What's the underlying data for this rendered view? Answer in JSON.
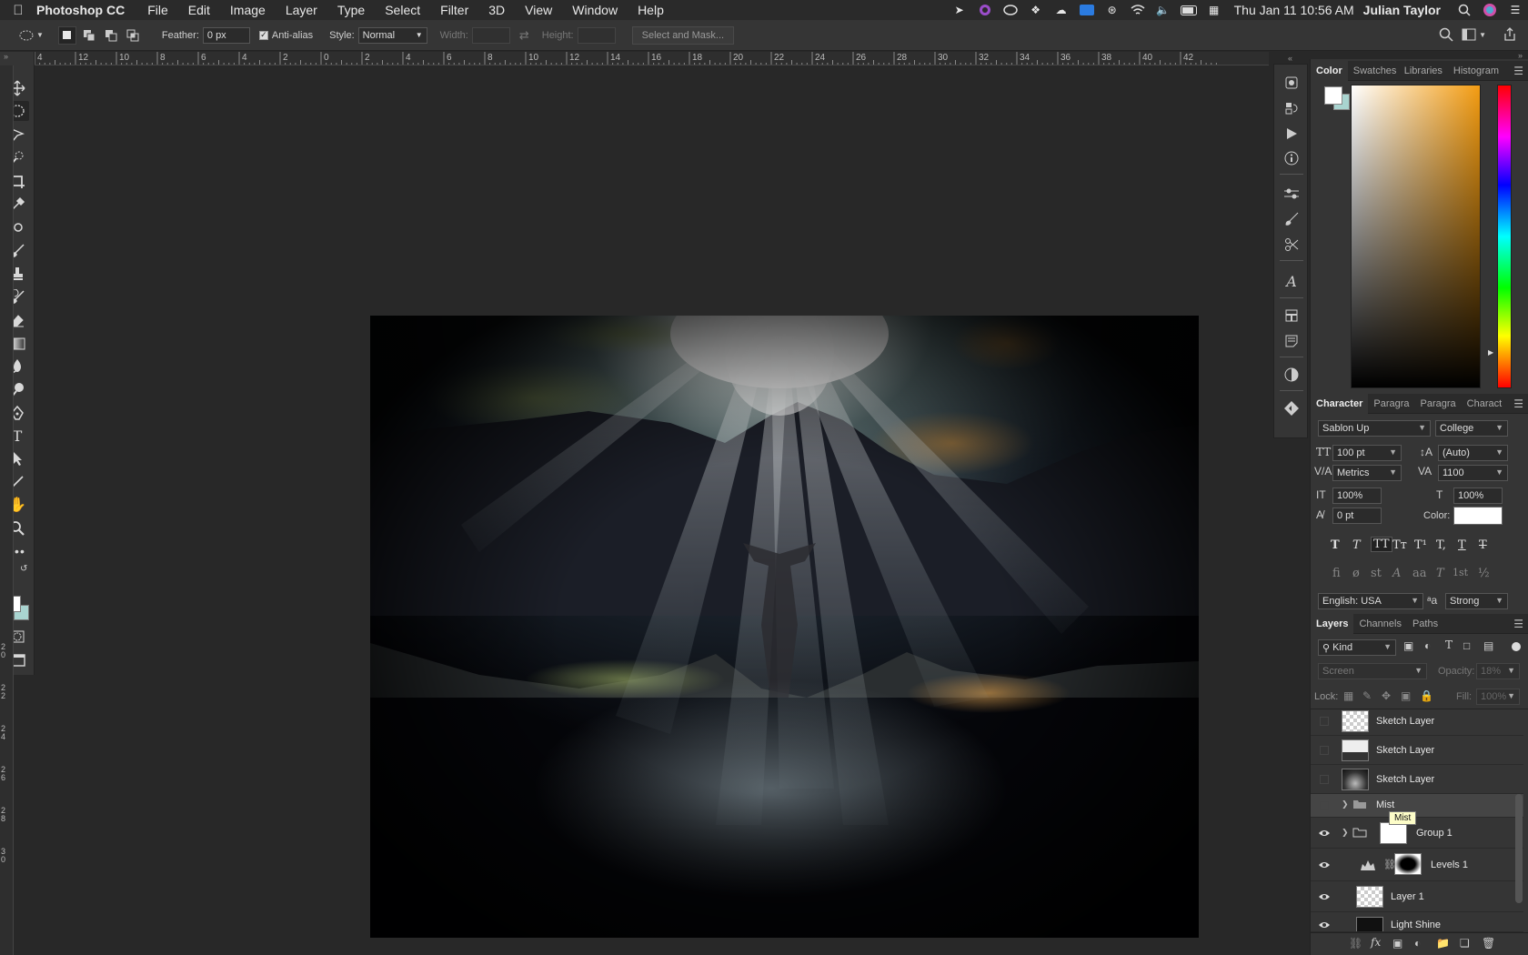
{
  "menubar": {
    "app_name": "Photoshop CC",
    "items": [
      "File",
      "Edit",
      "Image",
      "Layer",
      "Type",
      "Select",
      "Filter",
      "3D",
      "View",
      "Window",
      "Help"
    ],
    "clock": "Thu Jan 11  10:56 AM",
    "user": "Julian Taylor"
  },
  "options": {
    "feather_label": "Feather:",
    "feather_value": "0 px",
    "antialias_label": "Anti-alias",
    "style_label": "Style:",
    "style_value": "Normal",
    "width_label": "Width:",
    "height_label": "Height:",
    "select_mask": "Select and Mask..."
  },
  "ruler": {
    "h_labels": [
      "4",
      "12",
      "10",
      "8",
      "6",
      "4",
      "2",
      "0",
      "2",
      "4",
      "6",
      "8",
      "10",
      "12",
      "14",
      "16",
      "18",
      "20",
      "22",
      "24",
      "26",
      "28",
      "30",
      "32",
      "34",
      "36",
      "38",
      "40",
      "42"
    ],
    "v_labels": [
      "20",
      "22",
      "24",
      "26",
      "28",
      "30"
    ]
  },
  "color_panel": {
    "tabs": [
      "Color",
      "Swatches",
      "Libraries",
      "Histogram"
    ]
  },
  "character_panel": {
    "tabs": [
      "Character",
      "Paragra",
      "Paragra",
      "Charact"
    ],
    "font_family": "Sablon Up",
    "font_style": "College",
    "font_size": "100 pt",
    "leading": "(Auto)",
    "kerning": "Metrics",
    "tracking": "1100",
    "vertical_scale": "100%",
    "horizontal_scale": "100%",
    "baseline_shift": "0 pt",
    "color_label": "Color:",
    "language": "English: USA",
    "antialias": "Strong",
    "style_buttons": [
      "T",
      "T",
      "TT",
      "Tт",
      "T¹",
      "T,",
      "T",
      "T"
    ],
    "opentype_buttons": [
      "fi",
      "ø",
      "st",
      "A",
      "aa",
      "T",
      "1st",
      "½"
    ]
  },
  "layers_panel": {
    "tabs": [
      "Layers",
      "Channels",
      "Paths"
    ],
    "filter_kind": "Kind",
    "blend_mode": "Screen",
    "opacity_label": "Opacity:",
    "opacity_value": "18%",
    "lock_label": "Lock:",
    "fill_label": "Fill:",
    "fill_value": "100%",
    "layers": [
      {
        "name": "Sketch Layer",
        "visible": false
      },
      {
        "name": "Sketch Layer",
        "visible": false
      },
      {
        "name": "Sketch Layer",
        "visible": false
      },
      {
        "name": "Mist",
        "visible": false
      },
      {
        "name": "Group 1",
        "visible": true
      },
      {
        "name": "Levels 1",
        "visible": true
      },
      {
        "name": "Layer 1",
        "visible": true
      },
      {
        "name": "Light Shine",
        "visible": true
      }
    ],
    "tooltip": "Mist"
  }
}
